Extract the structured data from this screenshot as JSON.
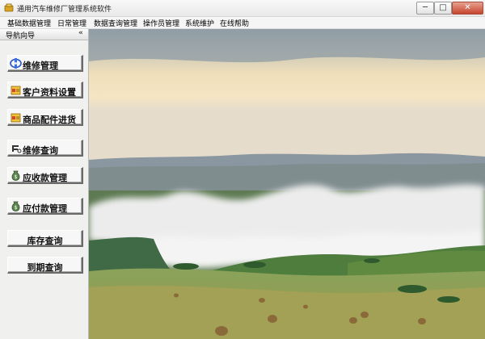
{
  "window": {
    "title": "通用汽车维修厂管理系统软件"
  },
  "titlebar": {
    "minimize": "─",
    "maximize": "□",
    "close": "✕"
  },
  "menu": [
    "基础数据管理",
    "日常管理",
    "数据查询管理",
    "操作员管理",
    "系统维护",
    "在线帮助"
  ],
  "nav": {
    "title": "导航向导",
    "collapse": "«",
    "buttons": [
      {
        "label": "维修管理",
        "icon": "maintenance-icon"
      },
      {
        "label": "客户资料设置",
        "icon": "folder-icon"
      },
      {
        "label": "商品配件进货",
        "icon": "folder-icon"
      },
      {
        "label": "维修查询",
        "icon": "query-icon"
      },
      {
        "label": "应收款管理",
        "icon": "money-bag-icon"
      },
      {
        "label": "应付款管理",
        "icon": "money-bag-icon"
      },
      {
        "label": "库存查询",
        "icon": ""
      },
      {
        "label": "到期查询",
        "icon": ""
      }
    ]
  },
  "colors": {
    "sky": "#f2e2bf",
    "hills": "#7a9a4e",
    "close_button": "#c5452f"
  }
}
